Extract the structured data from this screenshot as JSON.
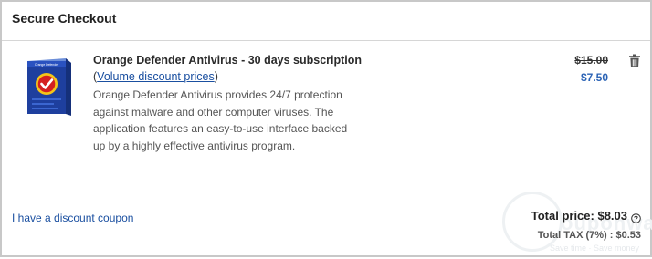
{
  "checkout": {
    "title": "Secure Checkout"
  },
  "product": {
    "name": "Orange Defender Antivirus - 30 days subscription",
    "discount_open": "(",
    "discount_link": "Volume discount prices",
    "discount_close": ")",
    "description": "Orange Defender Antivirus provides 24/7 protection against malware and other computer viruses. The application features an easy-to-use interface backed up by a highly effective antivirus program.",
    "old_price": "$15.00",
    "new_price": "$7.50",
    "image_icon": "software-box-icon",
    "box_brand": "Orange Defender"
  },
  "actions": {
    "remove_icon": "trash-icon",
    "coupon_link": "I have a discount coupon"
  },
  "totals": {
    "total_price": "Total price: $8.03",
    "total_tax": "Total TAX (7%) : $0.53",
    "help_icon": "help-circle-icon"
  },
  "watermark": {
    "text": "ouponwa",
    "tagline": "Save time · Save money"
  },
  "colors": {
    "link": "#1a4fa0",
    "new_price": "#2b63b5",
    "box_blue": "#1e3f9e",
    "badge_red": "#d42020",
    "badge_yellow": "#f5c518",
    "border": "#c8c8c8"
  }
}
